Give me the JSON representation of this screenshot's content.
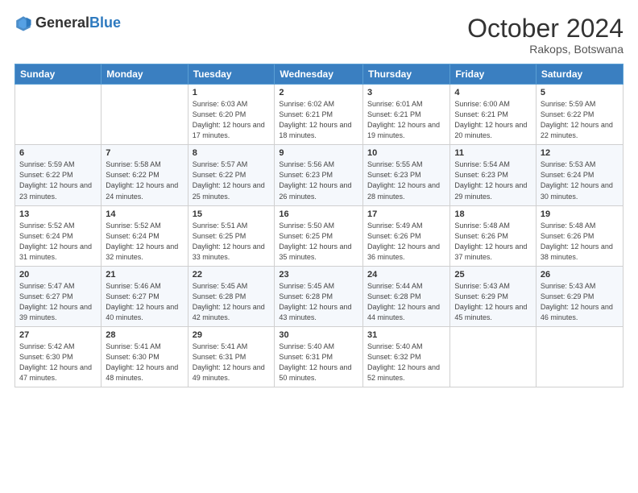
{
  "logo": {
    "general": "General",
    "blue": "Blue"
  },
  "title": {
    "month_year": "October 2024",
    "location": "Rakops, Botswana"
  },
  "weekdays": [
    "Sunday",
    "Monday",
    "Tuesday",
    "Wednesday",
    "Thursday",
    "Friday",
    "Saturday"
  ],
  "weeks": [
    [
      {
        "day": "",
        "info": ""
      },
      {
        "day": "",
        "info": ""
      },
      {
        "day": "1",
        "info": "Sunrise: 6:03 AM\nSunset: 6:20 PM\nDaylight: 12 hours and 17 minutes."
      },
      {
        "day": "2",
        "info": "Sunrise: 6:02 AM\nSunset: 6:21 PM\nDaylight: 12 hours and 18 minutes."
      },
      {
        "day": "3",
        "info": "Sunrise: 6:01 AM\nSunset: 6:21 PM\nDaylight: 12 hours and 19 minutes."
      },
      {
        "day": "4",
        "info": "Sunrise: 6:00 AM\nSunset: 6:21 PM\nDaylight: 12 hours and 20 minutes."
      },
      {
        "day": "5",
        "info": "Sunrise: 5:59 AM\nSunset: 6:22 PM\nDaylight: 12 hours and 22 minutes."
      }
    ],
    [
      {
        "day": "6",
        "info": "Sunrise: 5:59 AM\nSunset: 6:22 PM\nDaylight: 12 hours and 23 minutes."
      },
      {
        "day": "7",
        "info": "Sunrise: 5:58 AM\nSunset: 6:22 PM\nDaylight: 12 hours and 24 minutes."
      },
      {
        "day": "8",
        "info": "Sunrise: 5:57 AM\nSunset: 6:22 PM\nDaylight: 12 hours and 25 minutes."
      },
      {
        "day": "9",
        "info": "Sunrise: 5:56 AM\nSunset: 6:23 PM\nDaylight: 12 hours and 26 minutes."
      },
      {
        "day": "10",
        "info": "Sunrise: 5:55 AM\nSunset: 6:23 PM\nDaylight: 12 hours and 28 minutes."
      },
      {
        "day": "11",
        "info": "Sunrise: 5:54 AM\nSunset: 6:23 PM\nDaylight: 12 hours and 29 minutes."
      },
      {
        "day": "12",
        "info": "Sunrise: 5:53 AM\nSunset: 6:24 PM\nDaylight: 12 hours and 30 minutes."
      }
    ],
    [
      {
        "day": "13",
        "info": "Sunrise: 5:52 AM\nSunset: 6:24 PM\nDaylight: 12 hours and 31 minutes."
      },
      {
        "day": "14",
        "info": "Sunrise: 5:52 AM\nSunset: 6:24 PM\nDaylight: 12 hours and 32 minutes."
      },
      {
        "day": "15",
        "info": "Sunrise: 5:51 AM\nSunset: 6:25 PM\nDaylight: 12 hours and 33 minutes."
      },
      {
        "day": "16",
        "info": "Sunrise: 5:50 AM\nSunset: 6:25 PM\nDaylight: 12 hours and 35 minutes."
      },
      {
        "day": "17",
        "info": "Sunrise: 5:49 AM\nSunset: 6:26 PM\nDaylight: 12 hours and 36 minutes."
      },
      {
        "day": "18",
        "info": "Sunrise: 5:48 AM\nSunset: 6:26 PM\nDaylight: 12 hours and 37 minutes."
      },
      {
        "day": "19",
        "info": "Sunrise: 5:48 AM\nSunset: 6:26 PM\nDaylight: 12 hours and 38 minutes."
      }
    ],
    [
      {
        "day": "20",
        "info": "Sunrise: 5:47 AM\nSunset: 6:27 PM\nDaylight: 12 hours and 39 minutes."
      },
      {
        "day": "21",
        "info": "Sunrise: 5:46 AM\nSunset: 6:27 PM\nDaylight: 12 hours and 40 minutes."
      },
      {
        "day": "22",
        "info": "Sunrise: 5:45 AM\nSunset: 6:28 PM\nDaylight: 12 hours and 42 minutes."
      },
      {
        "day": "23",
        "info": "Sunrise: 5:45 AM\nSunset: 6:28 PM\nDaylight: 12 hours and 43 minutes."
      },
      {
        "day": "24",
        "info": "Sunrise: 5:44 AM\nSunset: 6:28 PM\nDaylight: 12 hours and 44 minutes."
      },
      {
        "day": "25",
        "info": "Sunrise: 5:43 AM\nSunset: 6:29 PM\nDaylight: 12 hours and 45 minutes."
      },
      {
        "day": "26",
        "info": "Sunrise: 5:43 AM\nSunset: 6:29 PM\nDaylight: 12 hours and 46 minutes."
      }
    ],
    [
      {
        "day": "27",
        "info": "Sunrise: 5:42 AM\nSunset: 6:30 PM\nDaylight: 12 hours and 47 minutes."
      },
      {
        "day": "28",
        "info": "Sunrise: 5:41 AM\nSunset: 6:30 PM\nDaylight: 12 hours and 48 minutes."
      },
      {
        "day": "29",
        "info": "Sunrise: 5:41 AM\nSunset: 6:31 PM\nDaylight: 12 hours and 49 minutes."
      },
      {
        "day": "30",
        "info": "Sunrise: 5:40 AM\nSunset: 6:31 PM\nDaylight: 12 hours and 50 minutes."
      },
      {
        "day": "31",
        "info": "Sunrise: 5:40 AM\nSunset: 6:32 PM\nDaylight: 12 hours and 52 minutes."
      },
      {
        "day": "",
        "info": ""
      },
      {
        "day": "",
        "info": ""
      }
    ]
  ]
}
